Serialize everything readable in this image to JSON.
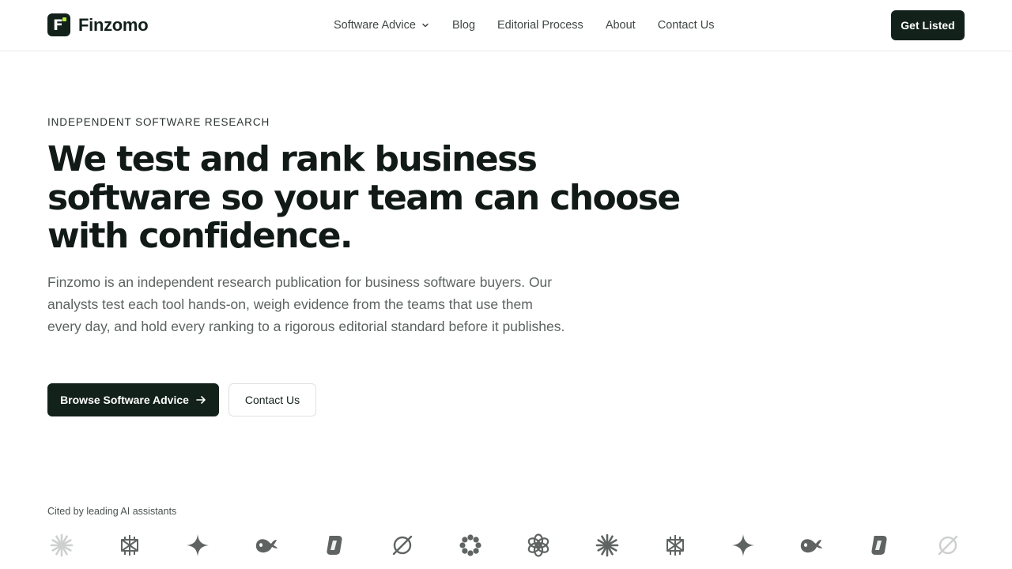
{
  "brand": {
    "name": "Finzomo",
    "logo_letter": "F",
    "accent_color": "#b8f03a",
    "dark_color": "#13211b"
  },
  "nav": {
    "items": [
      {
        "label": "Software Advice",
        "has_dropdown": true
      },
      {
        "label": "Blog"
      },
      {
        "label": "Editorial Process"
      },
      {
        "label": "About"
      },
      {
        "label": "Contact Us"
      }
    ],
    "cta_label": "Get Listed"
  },
  "hero": {
    "eyebrow": "INDEPENDENT SOFTWARE RESEARCH",
    "headline": "We test and rank business software so your team can choose with confidence.",
    "lede": "Finzomo is an independent research publication for business software buyers. Our analysts test each tool hands-on, weigh evidence from the teams that use them every day, and hold every ranking to a rigorous editorial standard before it publishes.",
    "primary_button": "Browse Software Advice",
    "primary_button_icon": "arrow-right-icon",
    "secondary_button": "Contact Us"
  },
  "cited": {
    "label": "Cited by leading AI assistants",
    "logos": [
      {
        "icon": "starburst-icon",
        "faded": true
      },
      {
        "icon": "perplexity-icon",
        "faded": false
      },
      {
        "icon": "sparkle-icon",
        "faded": false
      },
      {
        "icon": "whale-icon",
        "faded": false
      },
      {
        "icon": "copilot-icon",
        "faded": false
      },
      {
        "icon": "grok-icon",
        "faded": false
      },
      {
        "icon": "flower-icon",
        "faded": false
      },
      {
        "icon": "openai-icon",
        "faded": false
      },
      {
        "icon": "starburst-icon",
        "faded": false
      },
      {
        "icon": "perplexity-icon",
        "faded": false
      },
      {
        "icon": "sparkle-icon",
        "faded": false
      },
      {
        "icon": "whale-icon",
        "faded": false
      },
      {
        "icon": "copilot-icon",
        "faded": false
      },
      {
        "icon": "grok-icon",
        "faded": true
      }
    ]
  }
}
